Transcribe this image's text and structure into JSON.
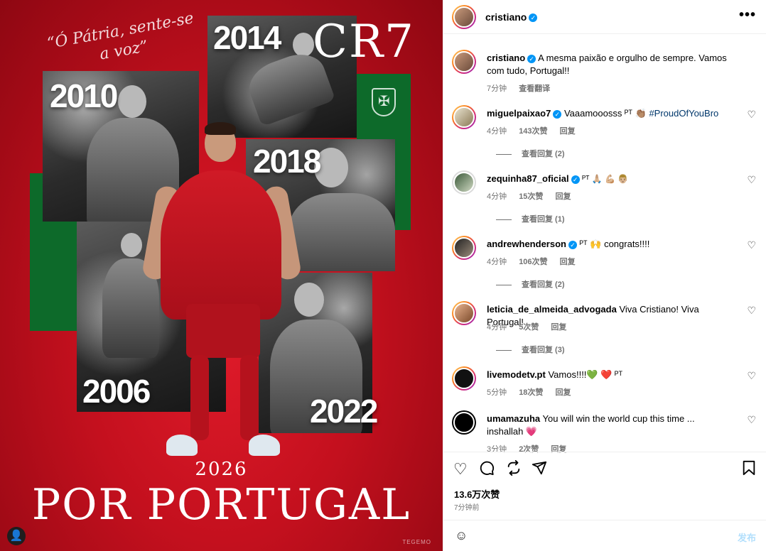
{
  "image": {
    "motto": "“Ó Pátria, sente-se a voz”",
    "cr7": "CR7",
    "years": [
      "2010",
      "2014",
      "2018",
      "2006",
      "2022"
    ],
    "year_2026": "2026",
    "title": "POR PORTUGAL",
    "watermark": "TEGEMO"
  },
  "header": {
    "username": "cristiano",
    "more_label": "•••"
  },
  "caption": {
    "username": "cristiano",
    "text": "A mesma paixão e orgulho de sempre. Vamos com tudo, Portugal!!",
    "time": "7分钟",
    "translate": "查看翻译"
  },
  "comments": [
    {
      "username": "miguelpaixao7",
      "text": "Vaaamooosss ᴾᵀ 👏🏽 ",
      "hashtag": "#ProudOfYouBro",
      "time": "4分钟",
      "likes": "143次赞",
      "reply": "回复",
      "view_replies": "查看回复 (2)"
    },
    {
      "username": "zequinha87_oficial",
      "text": "ᴾᵀ 🙏🏼 💪🏼 👨🏼",
      "hashtag": "",
      "time": "4分钟",
      "likes": "15次赞",
      "reply": "回复",
      "view_replies": "查看回复 (1)"
    },
    {
      "username": "andrewhenderson",
      "text": "ᴾᵀ 🙌 congrats!!!!",
      "hashtag": "",
      "time": "4分钟",
      "likes": "106次赞",
      "reply": "回复",
      "view_replies": "查看回复 (2)"
    },
    {
      "username": "leticia_de_almeida_advogada",
      "text": "Viva Cristiano! Viva Portugal!",
      "hashtag": "",
      "time": "4分钟",
      "likes": "5次赞",
      "reply": "回复",
      "view_replies": "查看回复 (3)"
    },
    {
      "username": "livemodetv.pt",
      "text": "Vamos!!!!💚 ❤️ ᴾᵀ",
      "hashtag": "",
      "time": "5分钟",
      "likes": "18次赞",
      "reply": "回复",
      "view_replies": ""
    },
    {
      "username": "umamazuha",
      "text": "You will win the world cup this time ... inshallah 💗",
      "hashtag": "",
      "time": "3分钟",
      "likes": "2次赞",
      "reply": "回复",
      "view_replies": ""
    }
  ],
  "footer": {
    "likes": "13.6万次赞",
    "time": "7分钟前",
    "comment_placeholder": "",
    "post_label": "发布"
  },
  "icons": {
    "heart": "heart-icon",
    "comment": "comment-icon",
    "share": "share-icon",
    "send": "send-icon",
    "bookmark": "bookmark-icon"
  },
  "colors": {
    "background_red": "#c4101e",
    "portugal_green": "#0d6a2a",
    "verified_blue": "#0095f6",
    "hashtag_blue": "#00376b",
    "post_button": "#b2dffc"
  }
}
